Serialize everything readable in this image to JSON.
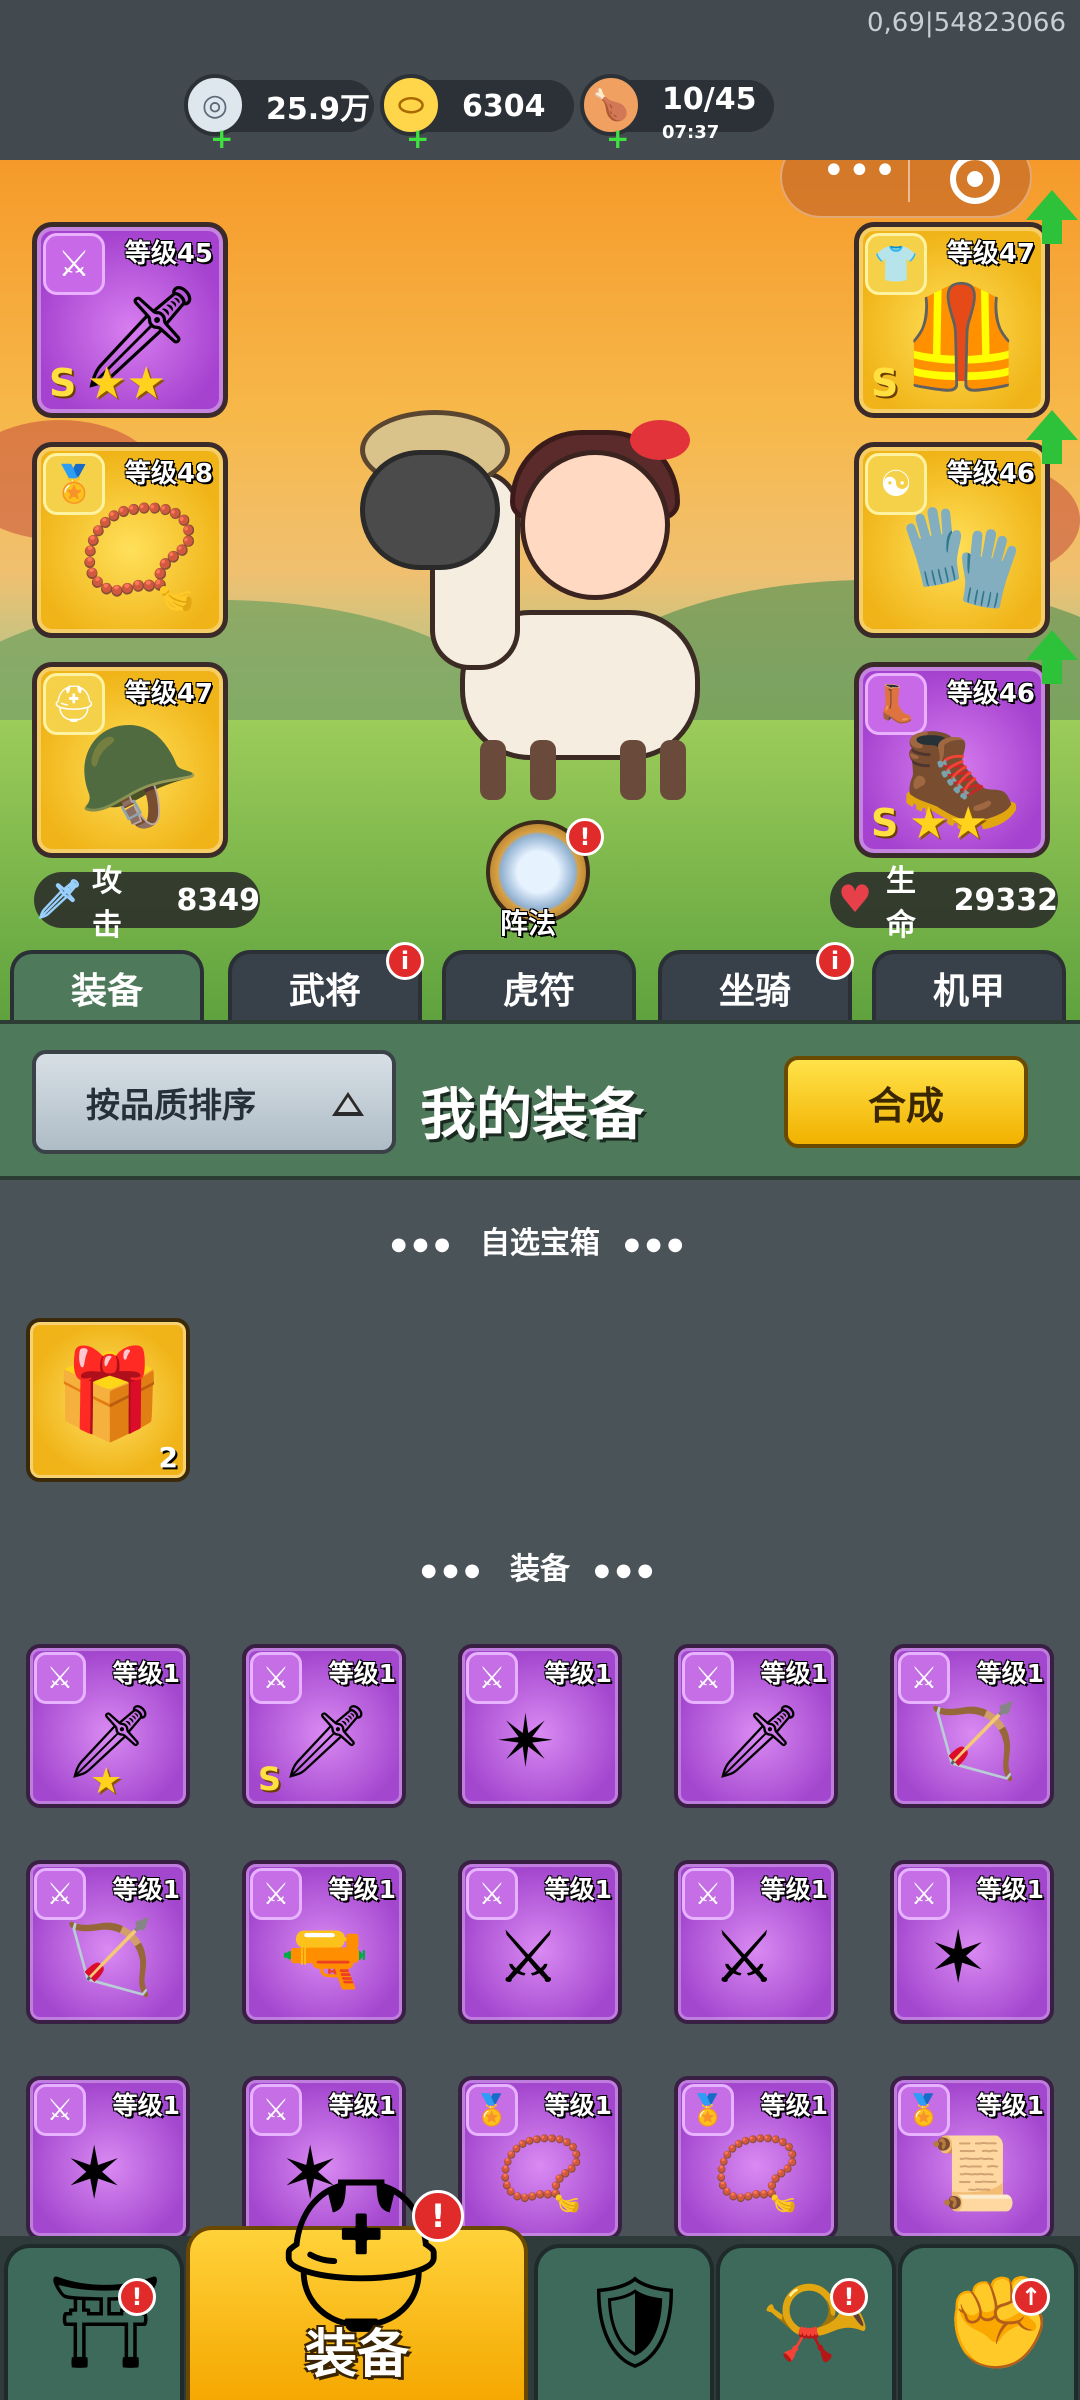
{
  "build_id": "0,69|54823066",
  "resources": {
    "silver": {
      "value": "25.9万",
      "icon": "coin-icon"
    },
    "gold": {
      "value": "6304",
      "icon": "gold-ingot-icon"
    },
    "stamina": {
      "value": "10/45",
      "timer": "07:37",
      "icon": "meat-icon"
    }
  },
  "capsule": {
    "menu_icon": "more-dots-icon",
    "close_icon": "target-icon"
  },
  "left_slots": [
    {
      "level": "等级45",
      "type": "sword",
      "grade": "S",
      "stars": "★★"
    },
    {
      "level": "等级48",
      "type": "medal"
    },
    {
      "level": "等级47",
      "type": "helmet"
    }
  ],
  "right_slots": [
    {
      "level": "等级47",
      "type": "armor",
      "grade": "S"
    },
    {
      "level": "等级46",
      "type": "yinyang"
    },
    {
      "level": "等级46",
      "type": "boots",
      "grade": "S",
      "stars": "★★"
    }
  ],
  "formation": {
    "label": "阵法",
    "badge": "!"
  },
  "stats": {
    "attack": {
      "label": "攻击",
      "value": "8349"
    },
    "health": {
      "label": "生命",
      "value": "29332"
    }
  },
  "tabs": [
    {
      "label": "装备",
      "active": true
    },
    {
      "label": "武将",
      "badge": "i"
    },
    {
      "label": "虎符"
    },
    {
      "label": "坐骑",
      "badge": "i"
    },
    {
      "label": "机甲"
    }
  ],
  "panel": {
    "sort_label": "按品质排序",
    "title": "我的装备",
    "synth_label": "合成"
  },
  "sections": {
    "chest_title": "自选宝箱",
    "equip_title": "装备"
  },
  "chest": {
    "count": "2"
  },
  "items": [
    {
      "level": "等级1",
      "art": "🗡",
      "star": "★"
    },
    {
      "level": "等级1",
      "art": "🗡",
      "grade": "S"
    },
    {
      "level": "等级1",
      "art": "✴"
    },
    {
      "level": "等级1",
      "art": "🗡"
    },
    {
      "level": "等级1",
      "art": "🏹"
    },
    {
      "level": "等级1",
      "art": "🏹"
    },
    {
      "level": "等级1",
      "art": "🔫"
    },
    {
      "level": "等级1",
      "art": "⚔"
    },
    {
      "level": "等级1",
      "art": "⚔"
    },
    {
      "level": "等级1",
      "art": "✶"
    },
    {
      "level": "等级1",
      "art": "✶"
    },
    {
      "level": "等级1",
      "art": "✶"
    },
    {
      "level": "等级1",
      "art": "📿",
      "type": "medal"
    },
    {
      "level": "等级1",
      "art": "📿",
      "type": "medal"
    },
    {
      "level": "等级1",
      "art": "📜",
      "type": "medal"
    }
  ],
  "bottom_nav": [
    {
      "name": "gate",
      "badge": "!"
    },
    {
      "name": "equipment",
      "label": "装备",
      "badge": "!",
      "active": true
    },
    {
      "name": "battle",
      "badge": ""
    },
    {
      "name": "horn",
      "badge": "!"
    },
    {
      "name": "upgrade",
      "badge": "↑"
    }
  ]
}
